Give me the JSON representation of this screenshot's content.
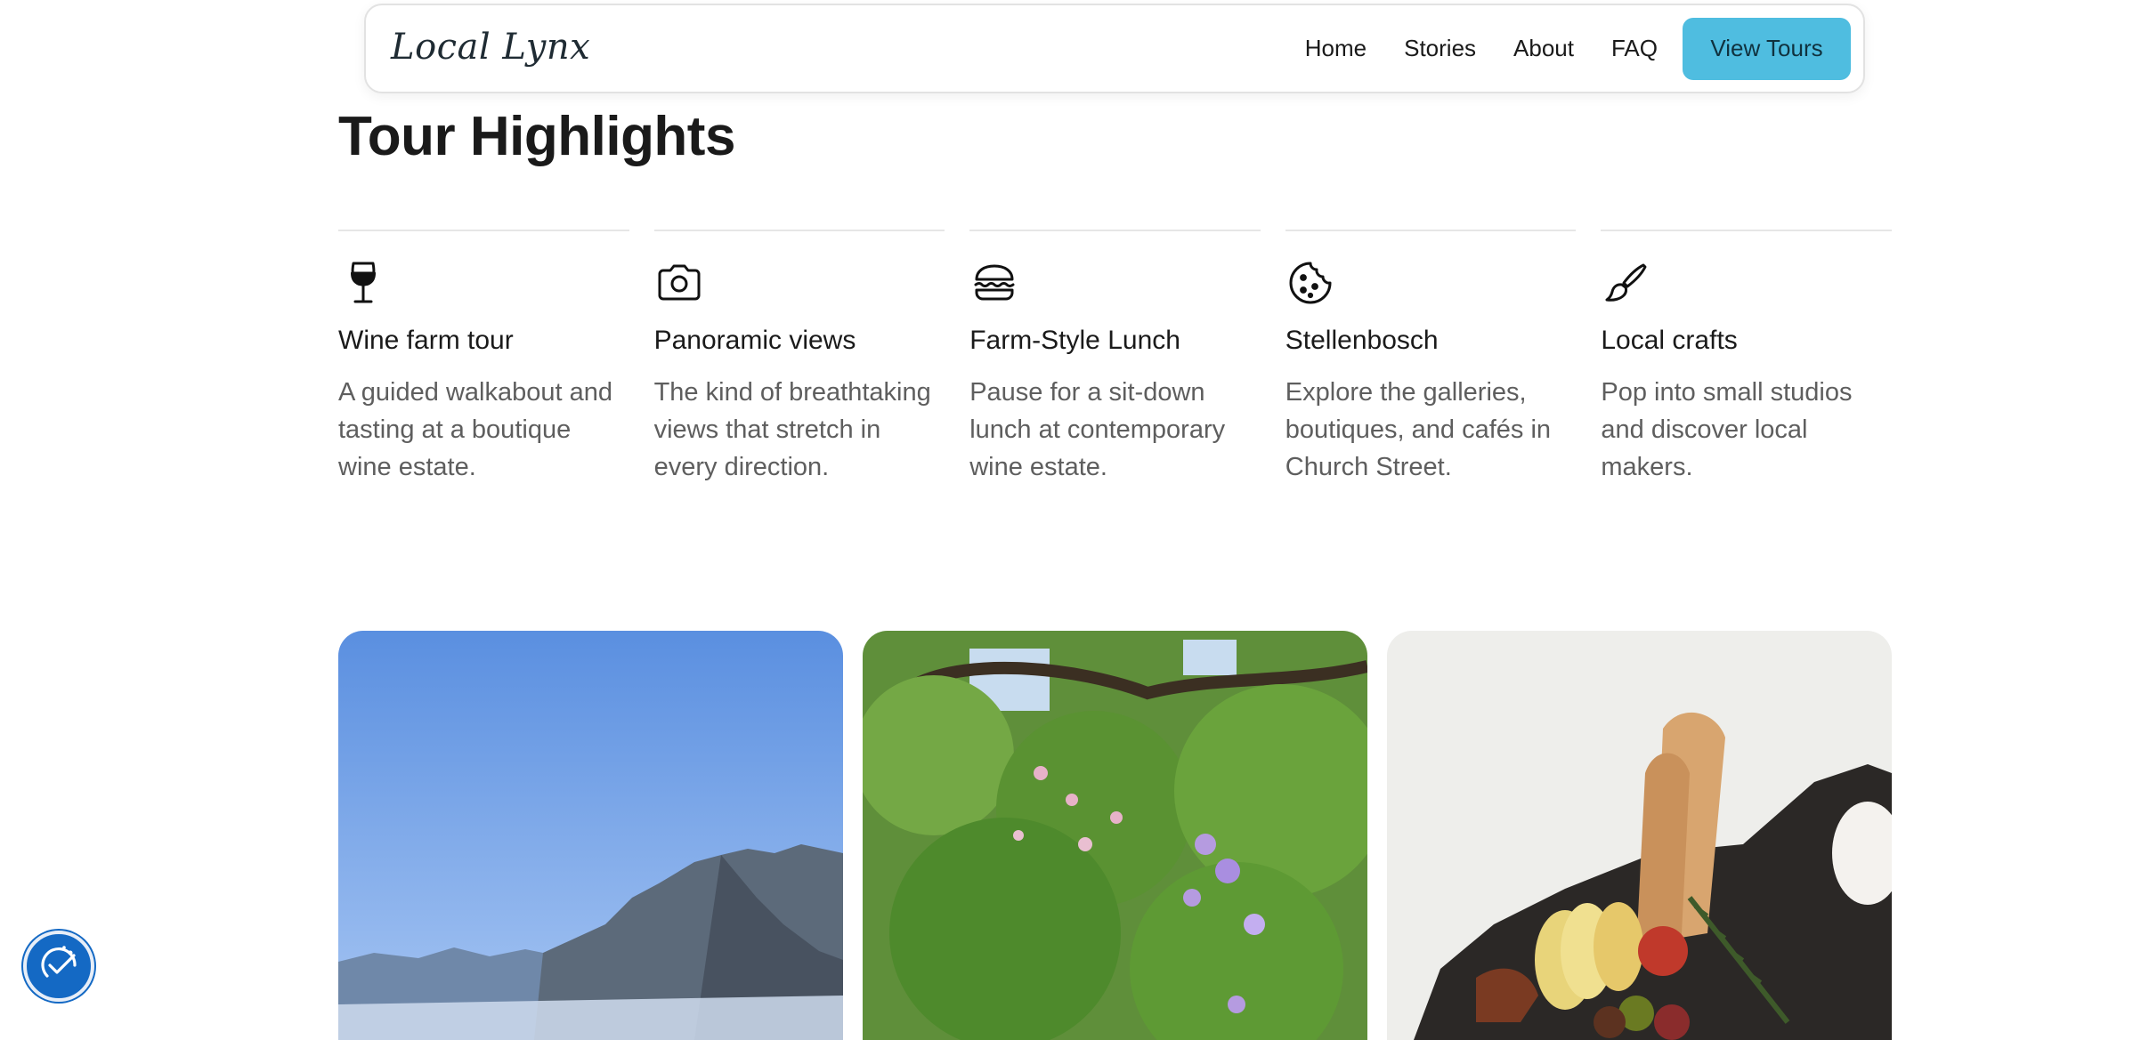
{
  "nav": {
    "brand": "Local Lynx",
    "links": [
      "Home",
      "Stories",
      "About",
      "FAQ"
    ],
    "cta_label": "View Tours",
    "cta_color": "#4fbde0"
  },
  "section": {
    "title": "Tour Highlights"
  },
  "highlights": [
    {
      "icon": "wine-glass-icon",
      "title": "Wine farm tour",
      "desc": "A guided walkabout and tasting at a boutique wine estate."
    },
    {
      "icon": "camera-icon",
      "title": "Panoramic views",
      "desc": "The kind of breathtaking views that stretch in every direction."
    },
    {
      "icon": "burger-icon",
      "title": "Farm-Style Lunch",
      "desc": "Pause for a sit-down lunch at contemporary wine estate."
    },
    {
      "icon": "cookie-icon",
      "title": "Stellenbosch",
      "desc": "Explore the galleries, boutiques, and cafés in Church Street."
    },
    {
      "icon": "paintbrush-icon",
      "title": "Local crafts",
      "desc": "Pop into small studios and discover local makers."
    }
  ],
  "gallery": [
    {
      "subject": "mountain-landscape"
    },
    {
      "subject": "garden-flowers"
    },
    {
      "subject": "food-platter"
    }
  ],
  "accessibility": {
    "icon": "accessibility-icon",
    "color": "#1469c4"
  }
}
